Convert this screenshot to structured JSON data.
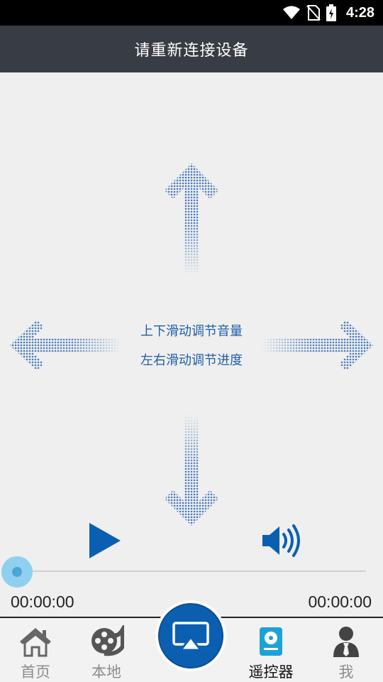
{
  "status_bar": {
    "time": "4:28"
  },
  "header": {
    "title": "请重新连接设备"
  },
  "gesture": {
    "hint_line1": "上下滑动调节音量",
    "hint_line2": "左右滑动调节进度"
  },
  "player": {
    "current_time": "00:00:00",
    "total_time": "00:00:00",
    "progress_fraction": 0
  },
  "nav": {
    "items": [
      {
        "label": "首页",
        "icon": "home-icon"
      },
      {
        "label": "本地",
        "icon": "film-reel-icon"
      },
      {
        "label": "遥控器",
        "icon": "remote-icon",
        "active": true
      },
      {
        "label": "我",
        "icon": "user-icon"
      }
    ],
    "center_icon": "screen-cast-icon"
  },
  "colors": {
    "accent": "#0b5fb1",
    "arrow": "#4a7fc2",
    "title_bar": "#383c44",
    "background": "#efefef"
  }
}
